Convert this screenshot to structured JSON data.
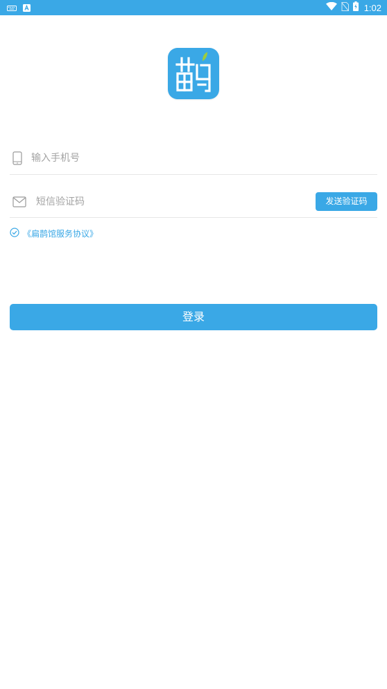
{
  "status_bar": {
    "time": "1:02",
    "left_icons": [
      "keyboard-icon",
      "a-app-icon"
    ],
    "right_icons": [
      "wifi-icon",
      "no-sim-icon",
      "battery-charging-icon"
    ],
    "background_color": "#3aa8e6"
  },
  "app": {
    "logo_glyph": "鹊",
    "brand_color": "#3aa8e6",
    "leaf_color": "#9ccc3c"
  },
  "login_form": {
    "phone_placeholder": "输入手机号",
    "phone_value": "",
    "code_placeholder": "短信验证码",
    "code_value": "",
    "send_code_label": "发送验证码",
    "agreement_checked": true,
    "agreement_label": "《扁鹊馆服务协议》",
    "login_label": "登录"
  }
}
